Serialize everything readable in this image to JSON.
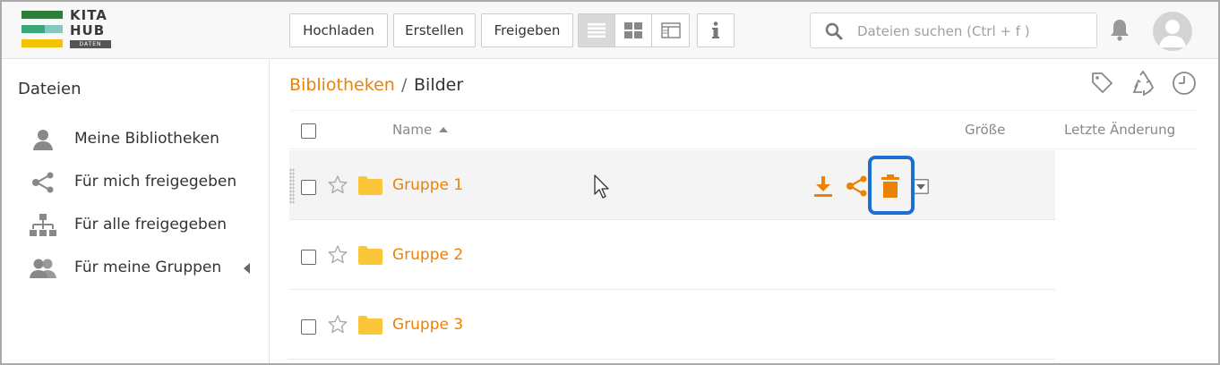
{
  "brand": {
    "line1": "KITA",
    "line2": "HUB",
    "line3": "DATEN",
    "colors": {
      "dark_green": "#2e7d3a",
      "teal": "#38a87a",
      "yellow": "#f2c300"
    }
  },
  "toolbar": {
    "upload_label": "Hochladen",
    "create_label": "Erstellen",
    "share_label": "Freigeben",
    "view_buttons": [
      "list-view-icon",
      "grid-view-icon",
      "column-view-icon"
    ],
    "info_icon": "info-icon"
  },
  "search": {
    "placeholder": "Dateien suchen (Ctrl + f )"
  },
  "sidebar": {
    "title": "Dateien",
    "items": [
      {
        "label": "Meine Bibliotheken",
        "icon": "user-icon"
      },
      {
        "label": "Für mich freigegeben",
        "icon": "share-icon"
      },
      {
        "label": "Für alle freigegeben",
        "icon": "org-chart-icon"
      },
      {
        "label": "Für meine Gruppen",
        "icon": "group-icon"
      }
    ]
  },
  "breadcrumb": {
    "root": "Bibliotheken",
    "separator": "/",
    "current": "Bilder"
  },
  "table": {
    "col_name": "Name",
    "col_size": "Größe",
    "col_modified": "Letzte Änderung",
    "rows": [
      {
        "name": "Gruppe 1"
      },
      {
        "name": "Gruppe 2"
      },
      {
        "name": "Gruppe 3"
      }
    ]
  },
  "colors": {
    "accent": "#eb8205",
    "highlight": "#1a6fd0"
  }
}
